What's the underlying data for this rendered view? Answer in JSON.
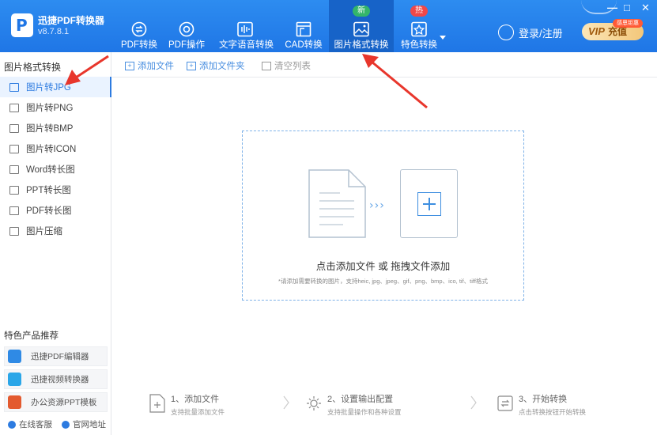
{
  "app": {
    "name": "迅捷PDF转换器",
    "version": "v8.7.8.1"
  },
  "nav": {
    "tabs": [
      {
        "label": "PDF转换",
        "icon": "pdf-convert-icon"
      },
      {
        "label": "PDF操作",
        "icon": "pdf-operate-icon"
      },
      {
        "label": "文字语音转换",
        "icon": "voice-icon"
      },
      {
        "label": "CAD转换",
        "icon": "cad-icon"
      },
      {
        "label": "图片格式转换",
        "icon": "image-icon",
        "badge": "新"
      },
      {
        "label": "特色转换",
        "icon": "star-icon",
        "badge": "热"
      }
    ]
  },
  "header": {
    "login": "登录/注册",
    "vip_label": "VIP",
    "vip_recharge": "充值",
    "vip_tag": "感恩钜惠"
  },
  "window": {
    "minimize": "—",
    "maximize": "□",
    "close": "✕"
  },
  "sidebar": {
    "title": "图片格式转换",
    "items": [
      {
        "label": "图片转JPG"
      },
      {
        "label": "图片转PNG"
      },
      {
        "label": "图片转BMP"
      },
      {
        "label": "图片转ICON"
      },
      {
        "label": "Word转长图"
      },
      {
        "label": "PPT转长图"
      },
      {
        "label": "PDF转长图"
      },
      {
        "label": "图片压缩"
      }
    ],
    "recommend_title": "特色产品推荐",
    "recommend": [
      {
        "label": "迅捷PDF编辑器",
        "color": "#2f8ae5"
      },
      {
        "label": "迅捷视频转换器",
        "color": "#2aa6e8"
      },
      {
        "label": "办公资源PPT模板",
        "color": "#e35a2f"
      }
    ],
    "footer": {
      "service": "在线客服",
      "website": "官网地址"
    }
  },
  "toolbar": {
    "add_file": "添加文件",
    "add_folder": "添加文件夹",
    "clear_list": "清空列表"
  },
  "dropzone": {
    "main": "点击添加文件 或 拖拽文件添加",
    "sub": "*请添加需要转换的图片，支持heic, jpg、jpeg、gif、png、bmp、ico, tif、tiff格式",
    "arrows": "›››"
  },
  "steps": [
    {
      "title": "1、添加文件",
      "desc": "支持批量添加文件"
    },
    {
      "title": "2、设置输出配置",
      "desc": "支持批量操作和各种设置"
    },
    {
      "title": "3、开始转换",
      "desc": "点击转换按钮开始转换"
    }
  ],
  "colors": {
    "header": "#1f76e6",
    "active_tab": "#1763c8",
    "accent": "#2d7be0",
    "annotation_arrow": "#e8362c"
  }
}
